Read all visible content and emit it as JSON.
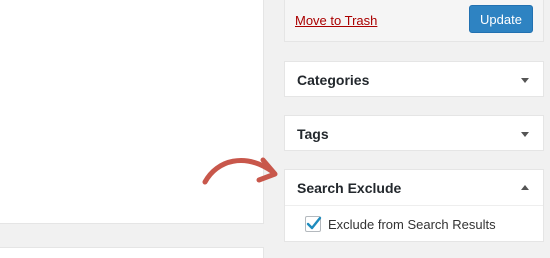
{
  "publish": {
    "trash_label": "Move to Trash",
    "update_label": "Update"
  },
  "panels": {
    "categories": {
      "title": "Categories",
      "toggle_icon": "triangle-down"
    },
    "tags": {
      "title": "Tags",
      "toggle_icon": "triangle-down"
    },
    "search_exclude": {
      "title": "Search Exclude",
      "toggle_icon": "triangle-up",
      "checkbox_label": "Exclude from Search Results",
      "checked": true
    }
  },
  "colors": {
    "accent": "#2e83c2",
    "trash_link": "#aa0000",
    "annotation_arrow": "#c8574b",
    "checkmark": "#1e8cbe"
  },
  "annotation": {
    "icon": "curved-arrow-icon"
  }
}
